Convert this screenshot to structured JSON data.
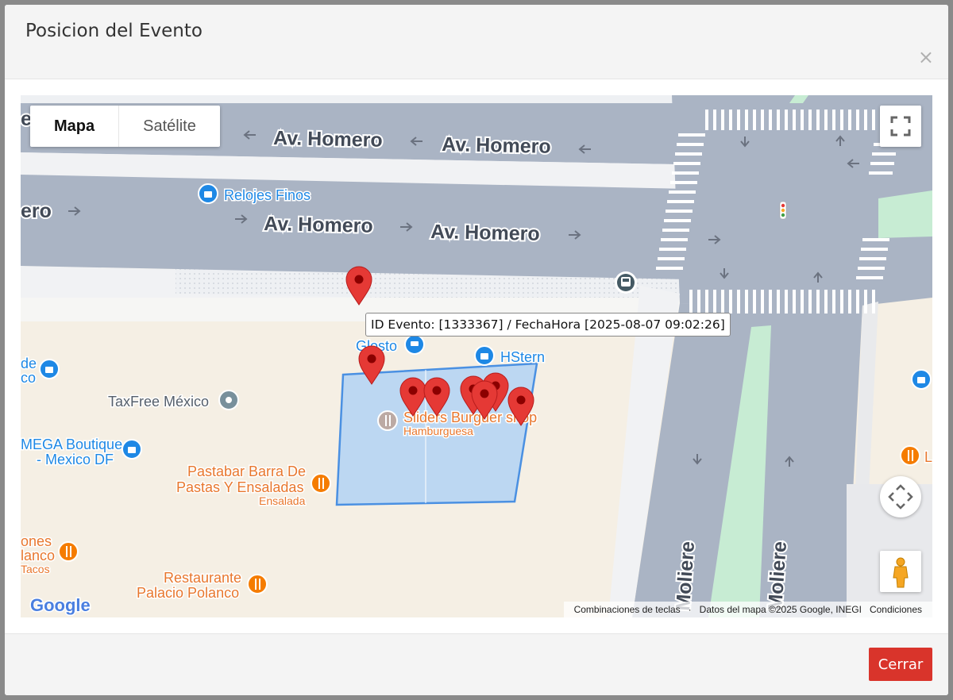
{
  "modal": {
    "title": "Posicion del Evento",
    "close_icon": "×",
    "close_button_label": "Cerrar"
  },
  "map": {
    "map_type_options": [
      "Mapa",
      "Satélite"
    ],
    "selected_map_type": "Mapa",
    "street_labels": {
      "homero_1": "Av. Homero",
      "homero_2": "Av. Homero",
      "homero_3": "Av. Homero",
      "homero_4": "Av. Homero",
      "homero_partial": "ero",
      "moliere_1": "Moliere",
      "moliere_2": "Moliere"
    },
    "pois": {
      "relojes": "Relojes Finos",
      "glosto": "Glosto",
      "hstern": "HStern",
      "taxfree": "TaxFree México",
      "mega_1": "MEGA Boutique",
      "mega_2": "- Mexico DF",
      "left_top_1": "de",
      "left_top_2": "co",
      "sliders": "Sliders Burguer shop",
      "sliders_sub": "Hamburguesa",
      "pastabar_1": "Pastabar Barra De",
      "pastabar_2": "Pastas Y Ensaladas",
      "pastabar_sub": "Ensalada",
      "ones_1": "ones",
      "ones_2": "lanco",
      "ones_sub": "Tacos",
      "restaurante_1": "Restaurante",
      "restaurante_2": "Palacio Polanco",
      "right_partial": "L"
    },
    "info_window": "ID Evento: [1333367]   /   FechaHora [2025-08-07 09:02:26]",
    "logo": "Google",
    "attribution": {
      "shortcuts": "Combinaciones de teclas",
      "data": "Datos del mapa ©2025 Google, INEGI",
      "terms": "Condiciones"
    },
    "icons": [
      "fullscreen-icon",
      "camera-control-icon",
      "pegman-icon",
      "bus-stop-icon",
      "traffic-light-icon"
    ],
    "colors": {
      "road": "#aab4c4",
      "building": "#f5efe4",
      "geofence_fill": "#b8d5f2",
      "geofence_stroke": "#4a90e2",
      "marker": "#e53935",
      "button": "#d9342b",
      "green_median": "#c7ecd3"
    }
  }
}
